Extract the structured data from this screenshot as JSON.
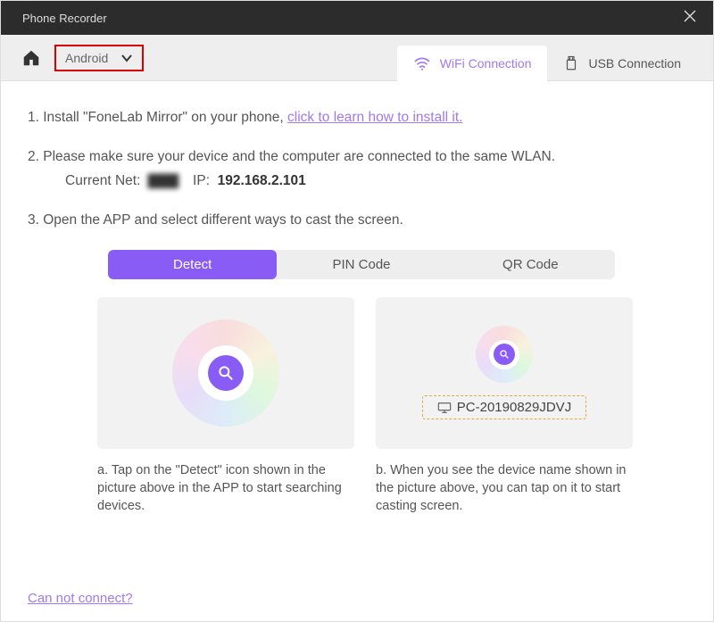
{
  "window": {
    "title": "Phone Recorder"
  },
  "toolbar": {
    "platform": "Android",
    "tabs": {
      "wifi": "WiFi Connection",
      "usb": "USB Connection"
    }
  },
  "steps": {
    "s1_prefix": "1. Install \"FoneLab Mirror\" on your phone, ",
    "s1_link": "click to learn how to install it.",
    "s2": "2. Please make sure your device and the computer are connected to the same WLAN.",
    "net_label": "Current Net:",
    "net_name": "▇▇▇",
    "ip_label": "IP:",
    "ip_value": "192.168.2.101",
    "s3": "3. Open the APP and select different ways to cast the screen."
  },
  "cast_tabs": {
    "detect": "Detect",
    "pin": "PIN Code",
    "qr": "QR Code"
  },
  "cards": {
    "pc_name": "PC-20190829JDVJ",
    "a": "a. Tap on the \"Detect\" icon shown in the picture above in the APP to start searching devices.",
    "b": "b. When you see the device name shown in the picture above, you can tap on it to start casting screen."
  },
  "footer": {
    "cannot_connect": "Can not connect?"
  }
}
